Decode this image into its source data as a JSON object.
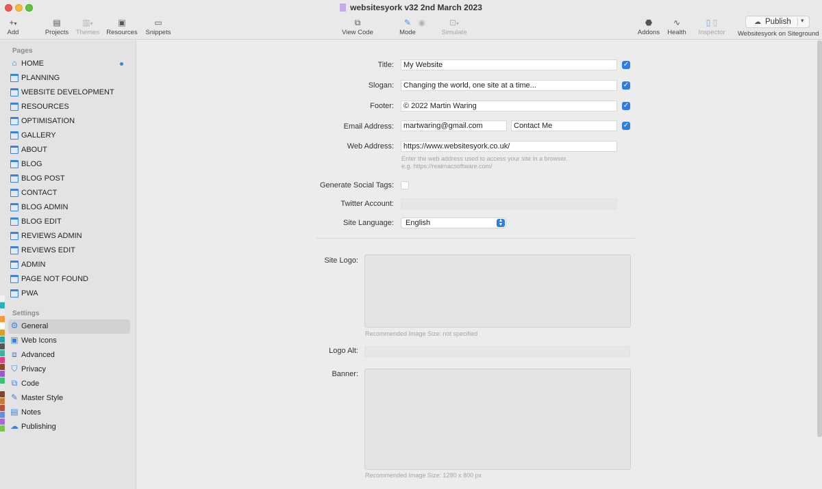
{
  "window": {
    "title": "websitesyork v32 2nd March 2023"
  },
  "toolbar": {
    "add": "Add",
    "projects": "Projects",
    "themes": "Themes",
    "resources": "Resources",
    "snippets": "Snippets",
    "view_code": "View Code",
    "mode": "Mode",
    "simulate": "Simulate",
    "addons": "Addons",
    "health": "Health",
    "inspector": "Inspector",
    "publish": "Publish",
    "publish_target": "Websitesyork on Siteground"
  },
  "sidebar": {
    "pages_heading": "Pages",
    "pages": [
      "HOME",
      "PLANNING",
      "WEBSITE  DEVELOPMENT",
      "RESOURCES",
      "OPTIMISATION",
      "GALLERY",
      "ABOUT",
      "BLOG",
      "BLOG POST",
      "CONTACT",
      "BLOG ADMIN",
      "BLOG EDIT",
      "REVIEWS ADMIN",
      "REVIEWS EDIT",
      "ADMIN",
      "PAGE NOT FOUND",
      "PWA"
    ],
    "settings_heading": "Settings",
    "settings": [
      "General",
      "Web Icons",
      "Advanced",
      "Privacy",
      "Code",
      "Master Style",
      "Notes",
      "Publishing"
    ],
    "selected_setting": "General"
  },
  "form": {
    "title_label": "Title:",
    "title_value": "My Website",
    "slogan_label": "Slogan:",
    "slogan_value": "Changing the world, one site at a time...",
    "footer_label": "Footer:",
    "footer_value": "© 2022 Martin Waring",
    "email_label": "Email Address:",
    "email_value": "martwaring@gmail.com",
    "email_link_text": "Contact Me",
    "web_label": "Web Address:",
    "web_value": "https://www.websitesyork.co.uk/",
    "web_hint_1": "Enter the web address used to access your site in a browser.",
    "web_hint_2": "e.g. https://realmacsoftware.com/",
    "social_label": "Generate Social Tags:",
    "twitter_label": "Twitter Account:",
    "twitter_value": "",
    "language_label": "Site Language:",
    "language_value": "English",
    "logo_label": "Site Logo:",
    "logo_hint": "Recommended Image Size: not specified",
    "logo_alt_label": "Logo Alt:",
    "logo_alt_value": "",
    "banner_label": "Banner:",
    "banner_hint": "Recommended Image Size: 1280 x 800 px"
  }
}
